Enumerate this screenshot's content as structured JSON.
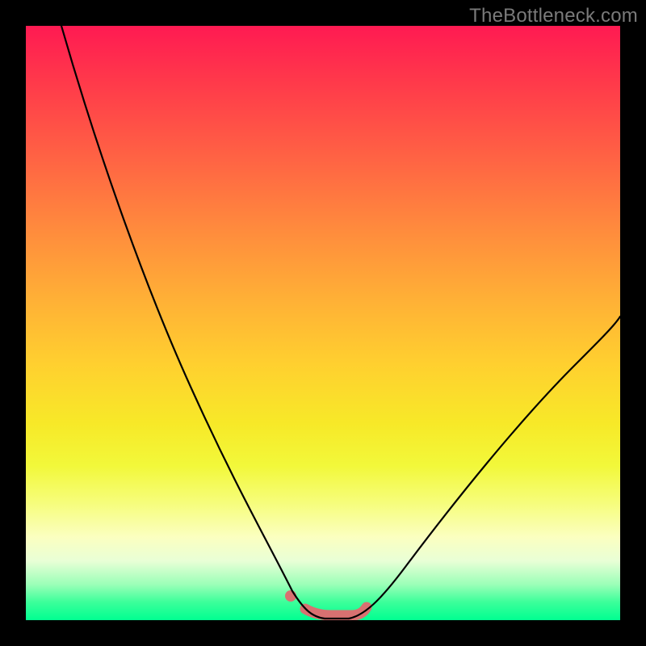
{
  "watermark": "TheBottleneck.com",
  "colors": {
    "frame": "#000000",
    "curve": "#000000",
    "valley_accent": "#d87171",
    "gradient_top": "#ff1a52",
    "gradient_bottom": "#00ff91"
  },
  "chart_data": {
    "type": "line",
    "title": "",
    "xlabel": "",
    "ylabel": "",
    "xlim": [
      0,
      100
    ],
    "ylim": [
      0,
      100
    ],
    "grid": false,
    "series": [
      {
        "name": "left-branch",
        "x": [
          6,
          10,
          15,
          20,
          25,
          30,
          35,
          40,
          44,
          48
        ],
        "values": [
          100,
          84,
          68,
          54,
          42,
          30,
          20,
          11,
          5,
          1
        ]
      },
      {
        "name": "right-branch",
        "x": [
          56,
          60,
          65,
          70,
          75,
          80,
          85,
          90,
          95,
          100
        ],
        "values": [
          1,
          4,
          9,
          15,
          22,
          29,
          36,
          43,
          50,
          56
        ]
      },
      {
        "name": "valley-floor",
        "x": [
          48,
          50,
          52,
          54,
          56
        ],
        "values": [
          1,
          0,
          0,
          0,
          1
        ]
      }
    ],
    "annotations": [
      {
        "name": "valley-highlight",
        "x_range": [
          47,
          57
        ],
        "y": 1,
        "style": "thick-accent"
      },
      {
        "name": "valley-marker-dot",
        "x": 45,
        "y": 3
      }
    ]
  }
}
